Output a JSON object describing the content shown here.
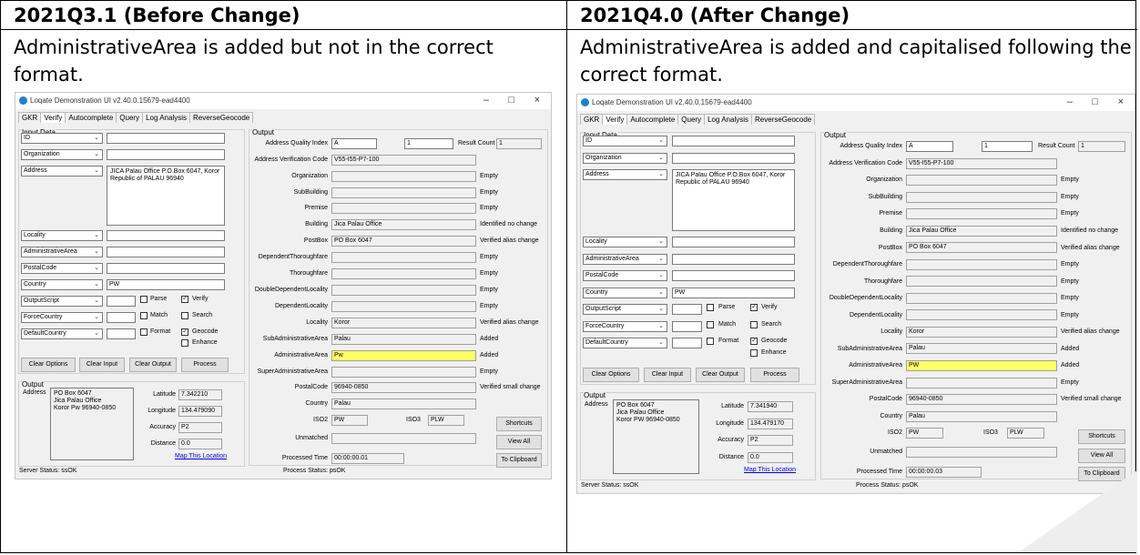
{
  "left": {
    "header": "2021Q3.1 (Before Change)",
    "description": "AdministrativeArea is added but not in the correct format.",
    "window": {
      "title": "Loqate Demonstration UI v2.40.0.15679-ead4400",
      "tabs": [
        "GKR",
        "Verify",
        "Autocomplete",
        "Query",
        "Log Analysis",
        "ReverseGeocode"
      ],
      "input_title": "Input Data",
      "input_rows": [
        {
          "field": "ID",
          "value": ""
        },
        {
          "field": "Organization",
          "value": ""
        },
        {
          "field": "Address",
          "value": ""
        },
        {
          "field": "Locality",
          "value": ""
        },
        {
          "field": "AdministrativeArea",
          "value": ""
        },
        {
          "field": "PostalCode",
          "value": ""
        },
        {
          "field": "Country",
          "value": "PW"
        },
        {
          "field": "OutputScript",
          "value": ""
        },
        {
          "field": "ForceCountry",
          "value": ""
        },
        {
          "field": "DefaultCountry",
          "value": ""
        }
      ],
      "address_value": "JICA Palau Office P.O.Box 6047, Koror Republic of PALAU 96940",
      "checkboxes": [
        {
          "label": "Parse",
          "checked": false
        },
        {
          "label": "Verify",
          "checked": true
        },
        {
          "label": "Match",
          "checked": false
        },
        {
          "label": "Search",
          "checked": false
        },
        {
          "label": "Format",
          "checked": false
        },
        {
          "label": "Geocode",
          "checked": true
        },
        {
          "label": "Enhance",
          "checked": false
        }
      ],
      "buttons": [
        "Clear Options",
        "Clear Input",
        "Clear Output",
        "Process"
      ],
      "output_lower_title": "Output",
      "address_label": "Address",
      "address_output": "PO Box 6047\nJica Palau Office\nKoror Pw 96940-0850",
      "latitude_label": "Latitude",
      "latitude": "7.342210",
      "longitude_label": "Longitude",
      "longitude": "134.479090",
      "accuracy_label": "Accuracy",
      "accuracy": "P2",
      "distance_label": "Distance",
      "distance": "0.0",
      "map_link": "Map This Location",
      "output_title": "Output",
      "aqi_label": "Address Quality Index",
      "aqi": "A",
      "result_count_spin": "1",
      "result_count_label": "Result Count",
      "result_count": "1",
      "avc_label": "Address Verification Code",
      "avc": "V55-I55-P7-100",
      "fields": [
        {
          "label": "Organization",
          "value": "",
          "status": "Empty"
        },
        {
          "label": "SubBuilding",
          "value": "",
          "status": "Empty"
        },
        {
          "label": "Premise",
          "value": "",
          "status": "Empty"
        },
        {
          "label": "Building",
          "value": "Jica Palau Office",
          "status": "Identified no change"
        },
        {
          "label": "PostBox",
          "value": "PO Box 6047",
          "status": "Verified alias change"
        },
        {
          "label": "DependentThoroughfare",
          "value": "",
          "status": "Empty"
        },
        {
          "label": "Thoroughfare",
          "value": "",
          "status": "Empty"
        },
        {
          "label": "DoubleDependentLocality",
          "value": "",
          "status": "Empty"
        },
        {
          "label": "DependentLocality",
          "value": "",
          "status": "Empty"
        },
        {
          "label": "Locality",
          "value": "Koror",
          "status": "Verified alias change"
        },
        {
          "label": "SubAdministrativeArea",
          "value": "Palau",
          "status": "Added"
        },
        {
          "label": "AdministrativeArea",
          "value": "Pw",
          "status": "Added"
        },
        {
          "label": "SuperAdministrativeArea",
          "value": "",
          "status": "Empty"
        },
        {
          "label": "PostalCode",
          "value": "96940-0850",
          "status": "Verified small change"
        },
        {
          "label": "Country",
          "value": "Palau",
          "status": ""
        }
      ],
      "iso2_label": "ISO2",
      "iso2": "PW",
      "iso3_label": "ISO3",
      "iso3": "PLW",
      "unmatched_label": "Unmatched",
      "unmatched": "",
      "processed_label": "Processed Time",
      "processed": "00:00:00.01",
      "side_buttons": [
        "Shortcuts",
        "View All",
        "To Clipboard"
      ],
      "server_status": "Server Status: ssOK",
      "process_status": "Process Status: psOK"
    }
  },
  "right": {
    "header": "2021Q4.0 (After Change)",
    "description": "AdministrativeArea is added and capitalised following the correct format.",
    "window": {
      "title": "Loqate Demonstration UI v2.40.0.15679-ead4400",
      "tabs": [
        "GKR",
        "Verify",
        "Autocomplete",
        "Query",
        "Log Analysis",
        "ReverseGeocode"
      ],
      "input_title": "Input Data",
      "input_rows": [
        {
          "field": "ID",
          "value": ""
        },
        {
          "field": "Organization",
          "value": ""
        },
        {
          "field": "Address",
          "value": ""
        },
        {
          "field": "Locality",
          "value": ""
        },
        {
          "field": "AdministrativeArea",
          "value": ""
        },
        {
          "field": "PostalCode",
          "value": ""
        },
        {
          "field": "Country",
          "value": "PW"
        },
        {
          "field": "OutputScript",
          "value": ""
        },
        {
          "field": "ForceCountry",
          "value": ""
        },
        {
          "field": "DefaultCountry",
          "value": ""
        }
      ],
      "address_value": "JICA Palau Office P.O.Box 6047, Koror Republic of PALAU 96940",
      "checkboxes": [
        {
          "label": "Parse",
          "checked": false
        },
        {
          "label": "Verify",
          "checked": true
        },
        {
          "label": "Match",
          "checked": false
        },
        {
          "label": "Search",
          "checked": false
        },
        {
          "label": "Format",
          "checked": false
        },
        {
          "label": "Geocode",
          "checked": true
        },
        {
          "label": "Enhance",
          "checked": false
        }
      ],
      "buttons": [
        "Clear Options",
        "Clear Input",
        "Clear Output",
        "Process"
      ],
      "output_lower_title": "Output",
      "address_label": "Address",
      "address_output": "PO Box 6047\nJica Palau Office\nKoror PW 96940-0850",
      "latitude_label": "Latitude",
      "latitude": "7.341940",
      "longitude_label": "Longitude",
      "longitude": "134.479170",
      "accuracy_label": "Accuracy",
      "accuracy": "P2",
      "distance_label": "Distance",
      "distance": "0.0",
      "map_link": "Map This Location",
      "output_title": "Output",
      "aqi_label": "Address Quality Index",
      "aqi": "A",
      "result_count_spin": "1",
      "result_count_label": "Result Count",
      "result_count": "1",
      "avc_label": "Address Verification Code",
      "avc": "V55-I55-P7-100",
      "fields": [
        {
          "label": "Organization",
          "value": "",
          "status": "Empty"
        },
        {
          "label": "SubBuilding",
          "value": "",
          "status": "Empty"
        },
        {
          "label": "Premise",
          "value": "",
          "status": "Empty"
        },
        {
          "label": "Building",
          "value": "Jica Palau Office",
          "status": "Identified no change"
        },
        {
          "label": "PostBox",
          "value": "PO Box 6047",
          "status": "Verified alias change"
        },
        {
          "label": "DependentThoroughfare",
          "value": "",
          "status": "Empty"
        },
        {
          "label": "Thoroughfare",
          "value": "",
          "status": "Empty"
        },
        {
          "label": "DoubleDependentLocality",
          "value": "",
          "status": "Empty"
        },
        {
          "label": "DependentLocality",
          "value": "",
          "status": "Empty"
        },
        {
          "label": "Locality",
          "value": "Koror",
          "status": "Verified alias change"
        },
        {
          "label": "SubAdministrativeArea",
          "value": "Palau",
          "status": "Added"
        },
        {
          "label": "AdministrativeArea",
          "value": "PW",
          "status": "Added"
        },
        {
          "label": "SuperAdministrativeArea",
          "value": "",
          "status": "Empty"
        },
        {
          "label": "PostalCode",
          "value": "96940-0850",
          "status": "Verified small change"
        },
        {
          "label": "Country",
          "value": "Palau",
          "status": ""
        }
      ],
      "iso2_label": "ISO2",
      "iso2": "PW",
      "iso3_label": "ISO3",
      "iso3": "PLW",
      "unmatched_label": "Unmatched",
      "unmatched": "",
      "processed_label": "Processed Time",
      "processed": "00:00:00.03",
      "side_buttons": [
        "Shortcuts",
        "View All",
        "To Clipboard"
      ],
      "server_status": "Server Status: ssOK",
      "process_status": "Process Status: psOK"
    }
  },
  "highlight_color": "#ffff66"
}
